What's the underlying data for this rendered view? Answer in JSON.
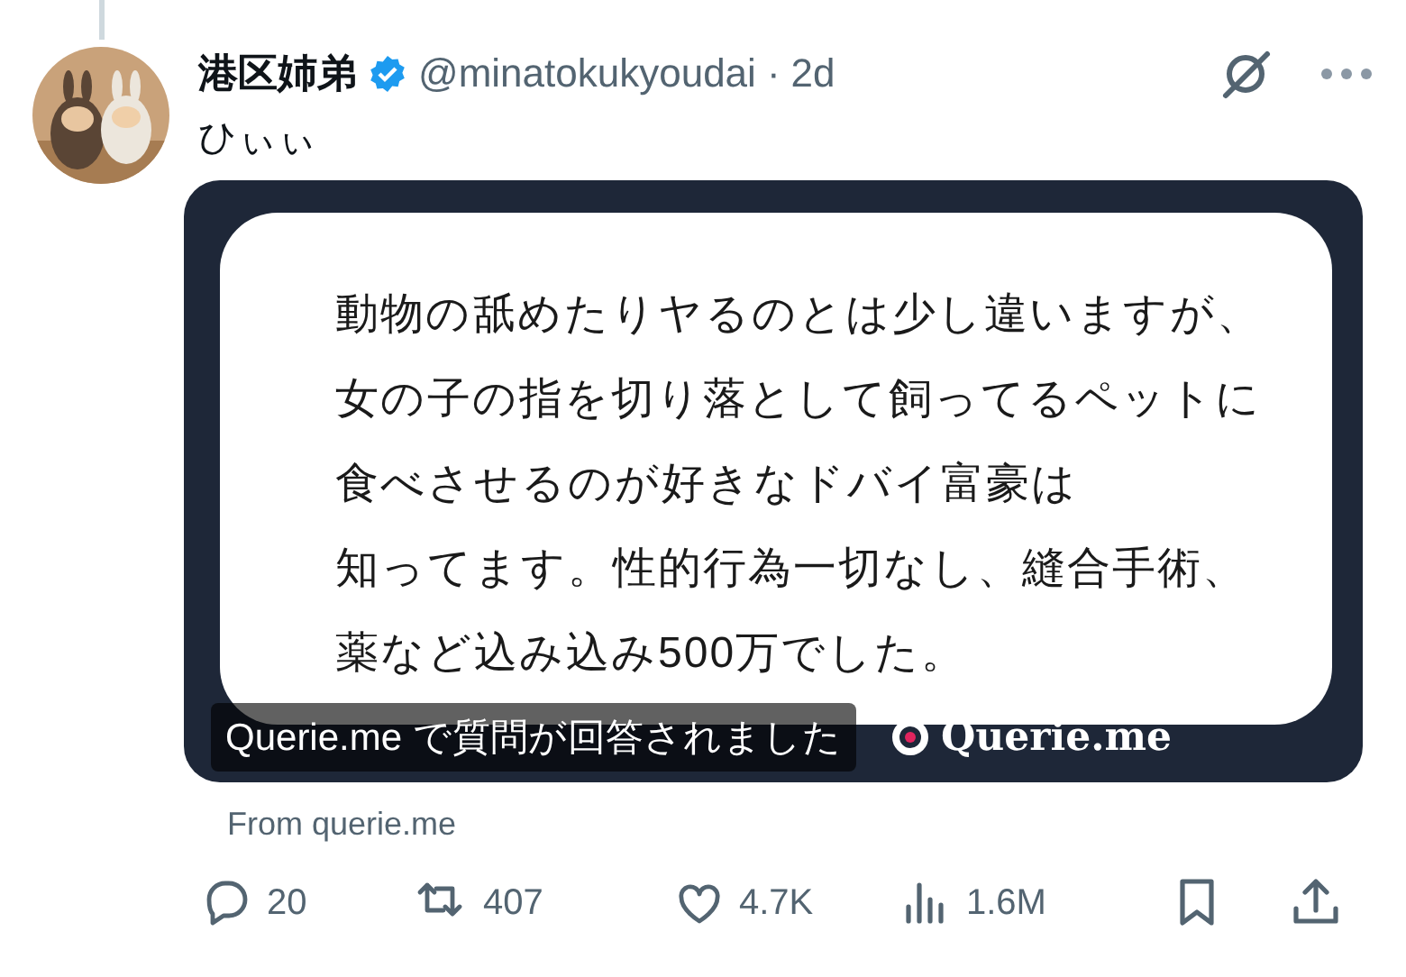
{
  "post": {
    "name": "港区姉弟",
    "verified": true,
    "handle": "@minatokukyoudai",
    "separator": "·",
    "time": "2d",
    "text": "ひぃぃ"
  },
  "card": {
    "lines": [
      "動物の舐めたりヤるのとは少し違いますが、",
      "女の子の指を切り落として飼ってるペットに",
      "食べさせるのが好きなドバイ富豪は",
      "知ってます。性的行為一切なし、縫合手術、",
      "薬など込み込み500万でした。"
    ],
    "caption": "Querie.me で質問が回答されました",
    "logo": "Querie.me"
  },
  "source": "From querie.me",
  "actions": [
    {
      "kind": "reply",
      "count": "20"
    },
    {
      "kind": "repost",
      "count": "407"
    },
    {
      "kind": "like",
      "count": "4.7K"
    },
    {
      "kind": "views",
      "count": "1.6M"
    },
    {
      "kind": "bookmark"
    },
    {
      "kind": "share"
    }
  ]
}
